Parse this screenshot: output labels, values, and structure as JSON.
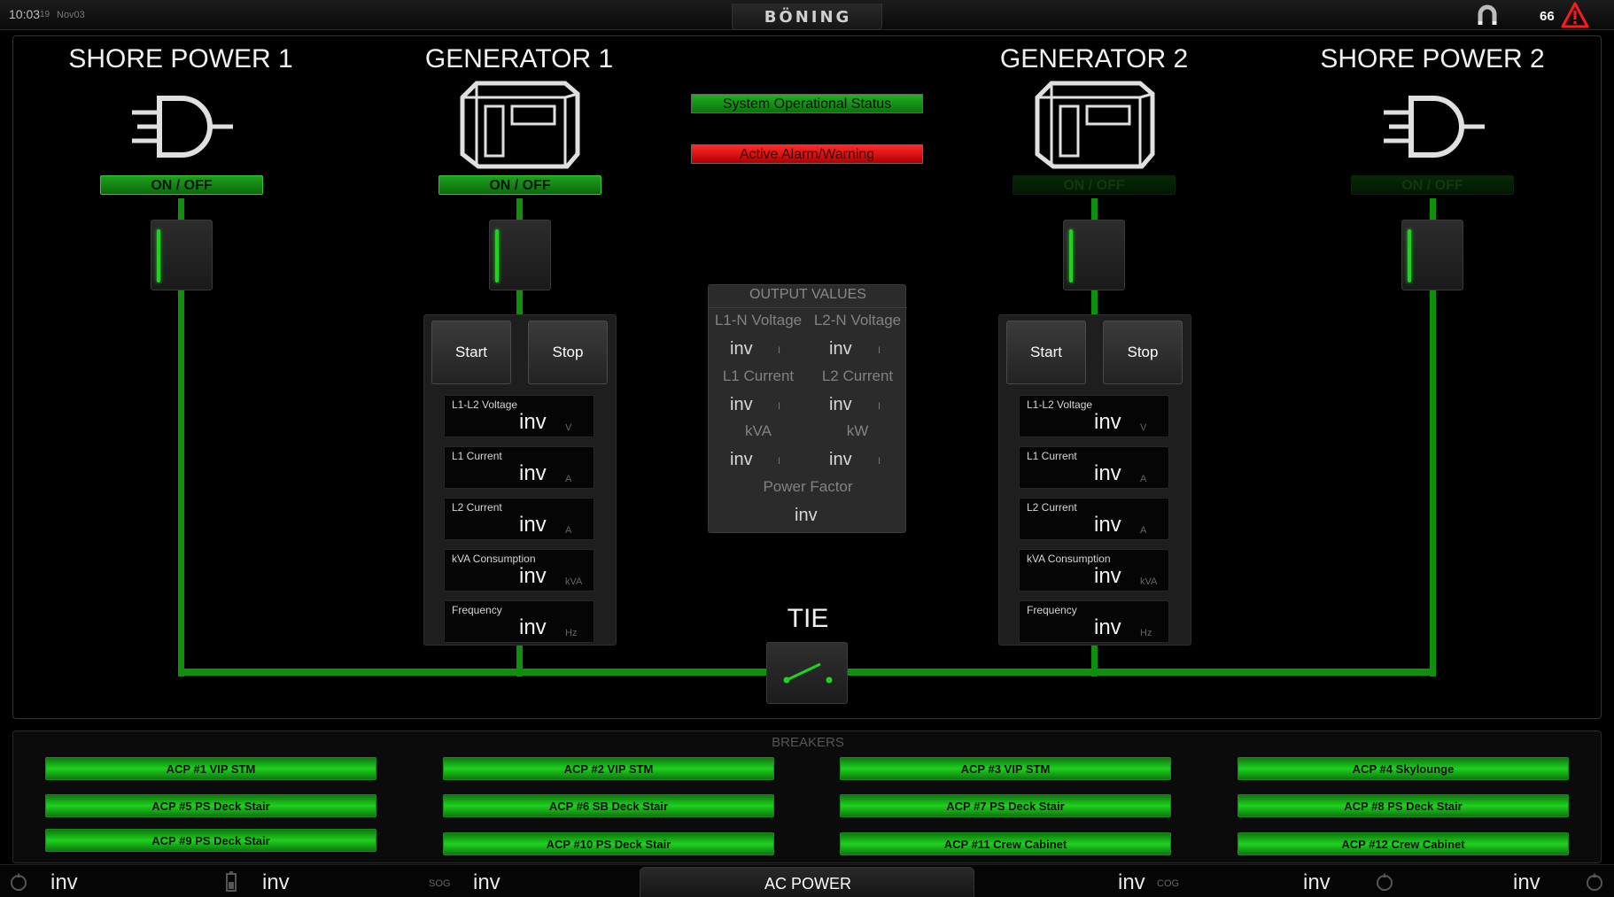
{
  "topbar": {
    "time": "10:03",
    "seconds": "19",
    "date": "Nov03",
    "logo": "BÖNING",
    "alarm_count": "66"
  },
  "sources": {
    "shore1": {
      "title": "SHORE POWER 1",
      "onoff": "ON / OFF",
      "state": "on"
    },
    "gen1": {
      "title": "GENERATOR 1",
      "onoff": "ON / OFF",
      "state": "on"
    },
    "gen2": {
      "title": "GENERATOR 2",
      "onoff": "ON / OFF",
      "state": "off"
    },
    "shore2": {
      "title": "SHORE POWER 2",
      "onoff": "ON / OFF",
      "state": "off"
    }
  },
  "status": {
    "operational": "System Operational Status",
    "alarm": "Active Alarm/Warning"
  },
  "generator_panel": {
    "start": "Start",
    "stop": "Stop",
    "readings": [
      {
        "label": "L1-L2 Voltage",
        "value": "inv",
        "unit": "V"
      },
      {
        "label": "L1 Current",
        "value": "inv",
        "unit": "A"
      },
      {
        "label": "L2 Current",
        "value": "inv",
        "unit": "A"
      },
      {
        "label": "kVA Consumption",
        "value": "inv",
        "unit": "kVA"
      },
      {
        "label": "Frequency",
        "value": "inv",
        "unit": "Hz"
      }
    ]
  },
  "output": {
    "header": "OUTPUT VALUES",
    "rows": [
      {
        "left_label": "L1-N Voltage",
        "right_label": "L2-N Voltage",
        "left_value": "inv",
        "right_value": "inv",
        "sep": "I"
      },
      {
        "left_label": "L1 Current",
        "right_label": "L2 Current",
        "left_value": "inv",
        "right_value": "inv",
        "sep": "I"
      },
      {
        "left_label": "kVA",
        "right_label": "kW",
        "left_value": "inv",
        "right_value": "inv",
        "sep": "I"
      }
    ],
    "pf_label": "Power Factor",
    "pf_value": "inv"
  },
  "tie": {
    "title": "TIE"
  },
  "breakers": {
    "title": "BREAKERS",
    "items": [
      "ACP #1 VIP STM",
      "ACP #2 VIP STM",
      "ACP #3 VIP STM",
      "ACP #4 Skylounge",
      "ACP #5 PS Deck Stair",
      "ACP #6 SB Deck Stair",
      "ACP #7 PS Deck Stair",
      "ACP #8 PS Deck Stair",
      "ACP #9 PS Deck Stair",
      "ACP #10 PS Deck Stair",
      "ACP #11 Crew Cabinet",
      "ACP #12 Crew Cabinet"
    ]
  },
  "footer": {
    "title": "AC POWER",
    "v1": "inv",
    "v2": "inv",
    "v3": "inv",
    "v4": "inv",
    "v5": "inv",
    "v6": "inv",
    "sog": "SOG",
    "cog": "COG"
  },
  "colors": {
    "line_green": "#0e8f0e",
    "on_green": "#1fa01f",
    "alarm_red": "#e00000"
  },
  "icons": [
    "magnet-icon",
    "alarm-warning-icon",
    "plug-icon",
    "generator-icon",
    "switch-led-icon",
    "compass-icon",
    "battery-icon"
  ]
}
